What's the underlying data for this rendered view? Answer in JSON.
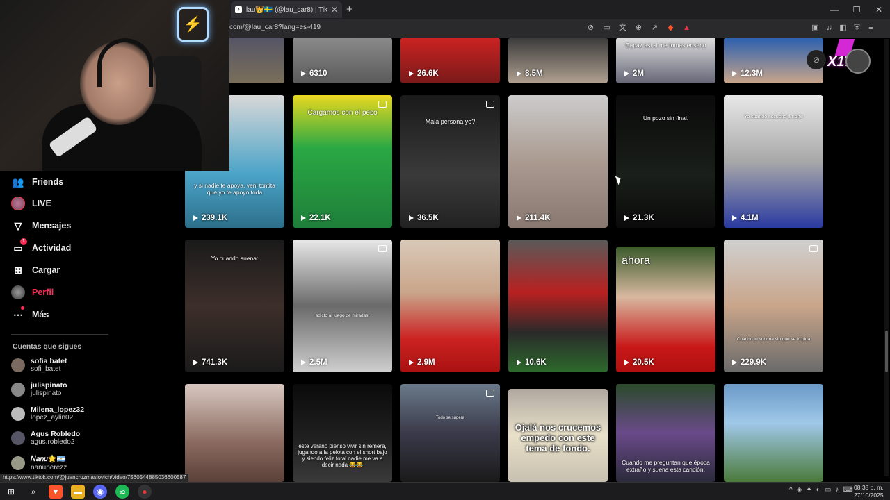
{
  "browser": {
    "tab_title": "lau👑🇸🇪 (@lau_car8) | TikTok",
    "url": "com/@lau_car8?lang=es-419",
    "status_link": "https://www.tiktok.com/@juancruzmaslovich/video/7560544885036600587"
  },
  "sidebar": {
    "items": [
      {
        "label": "Friends",
        "icon": "friends-icon"
      },
      {
        "label": "LIVE",
        "icon": "live-icon"
      },
      {
        "label": "Mensajes",
        "icon": "messages-icon"
      },
      {
        "label": "Actividad",
        "icon": "activity-icon",
        "badge": "1"
      },
      {
        "label": "Cargar",
        "icon": "upload-icon"
      },
      {
        "label": "Perfil",
        "icon": "profile-avatar"
      },
      {
        "label": "Más",
        "icon": "more-icon"
      }
    ],
    "following_title": "Cuentas que sigues",
    "following": [
      {
        "name": "sofia batet",
        "handle": "sofi_batet"
      },
      {
        "name": "julispinato",
        "handle": "julispinato"
      },
      {
        "name": "Milena_lopez32",
        "handle": "lopez_aylin02"
      },
      {
        "name": "Agus Robledo",
        "handle": "agus.robledo2"
      },
      {
        "name": "𝑁𝑎𝑛𝑢🌟🇦🇷",
        "handle": "nanuperezz"
      }
    ]
  },
  "logo": {
    "text": "X17"
  },
  "videos": {
    "row0": [
      {
        "views": "6310",
        "caption": ""
      },
      {
        "views": "26.6K",
        "caption": ""
      },
      {
        "views": "8.5M",
        "caption": ""
      },
      {
        "views": "2M",
        "caption": "Capaz asi si me tomas enserio"
      },
      {
        "views": "12.3M",
        "caption": ""
      }
    ],
    "row1": [
      {
        "views": "239.1K",
        "caption": "y si nadie te apoya, veni tontita que yo te apoyo toda"
      },
      {
        "views": "22.1K",
        "caption": "Cargamos con el peso"
      },
      {
        "views": "36.5K",
        "caption": "Mala persona yo?"
      },
      {
        "views": "211.4K",
        "caption": ""
      },
      {
        "views": "21.3K",
        "caption": "Un pozo sin final."
      },
      {
        "views": "4.1M",
        "caption": "Yo cuando escucho a norte"
      }
    ],
    "row2": [
      {
        "views": "741.3K",
        "caption": "Yo cuando suena:"
      },
      {
        "views": "2.5M",
        "caption": "adicto al juego de miradas."
      },
      {
        "views": "2.9M",
        "caption": ""
      },
      {
        "views": "10.6K",
        "caption": ""
      },
      {
        "views": "20.5K",
        "caption": "ahora"
      },
      {
        "views": "229.9K",
        "caption": "Cuando tu sobrina sin que se lo pida"
      }
    ],
    "row3": [
      {
        "caption": ""
      },
      {
        "caption": "este verano pienso vivir sin remera, jugando a la pelota con el short bajo y siendo feliz total nadie me va a decir nada 😂😂"
      },
      {
        "caption": "Todo se supera"
      },
      {
        "caption": "Ojalá nos crucemos empedo con este tema de fondo."
      },
      {
        "caption": "Cuando me preguntan que época extraño y suena esta canción:"
      },
      {
        "caption": ""
      }
    ]
  },
  "taskbar": {
    "time": "08:38 p. m.",
    "date": "27/10/2025"
  }
}
